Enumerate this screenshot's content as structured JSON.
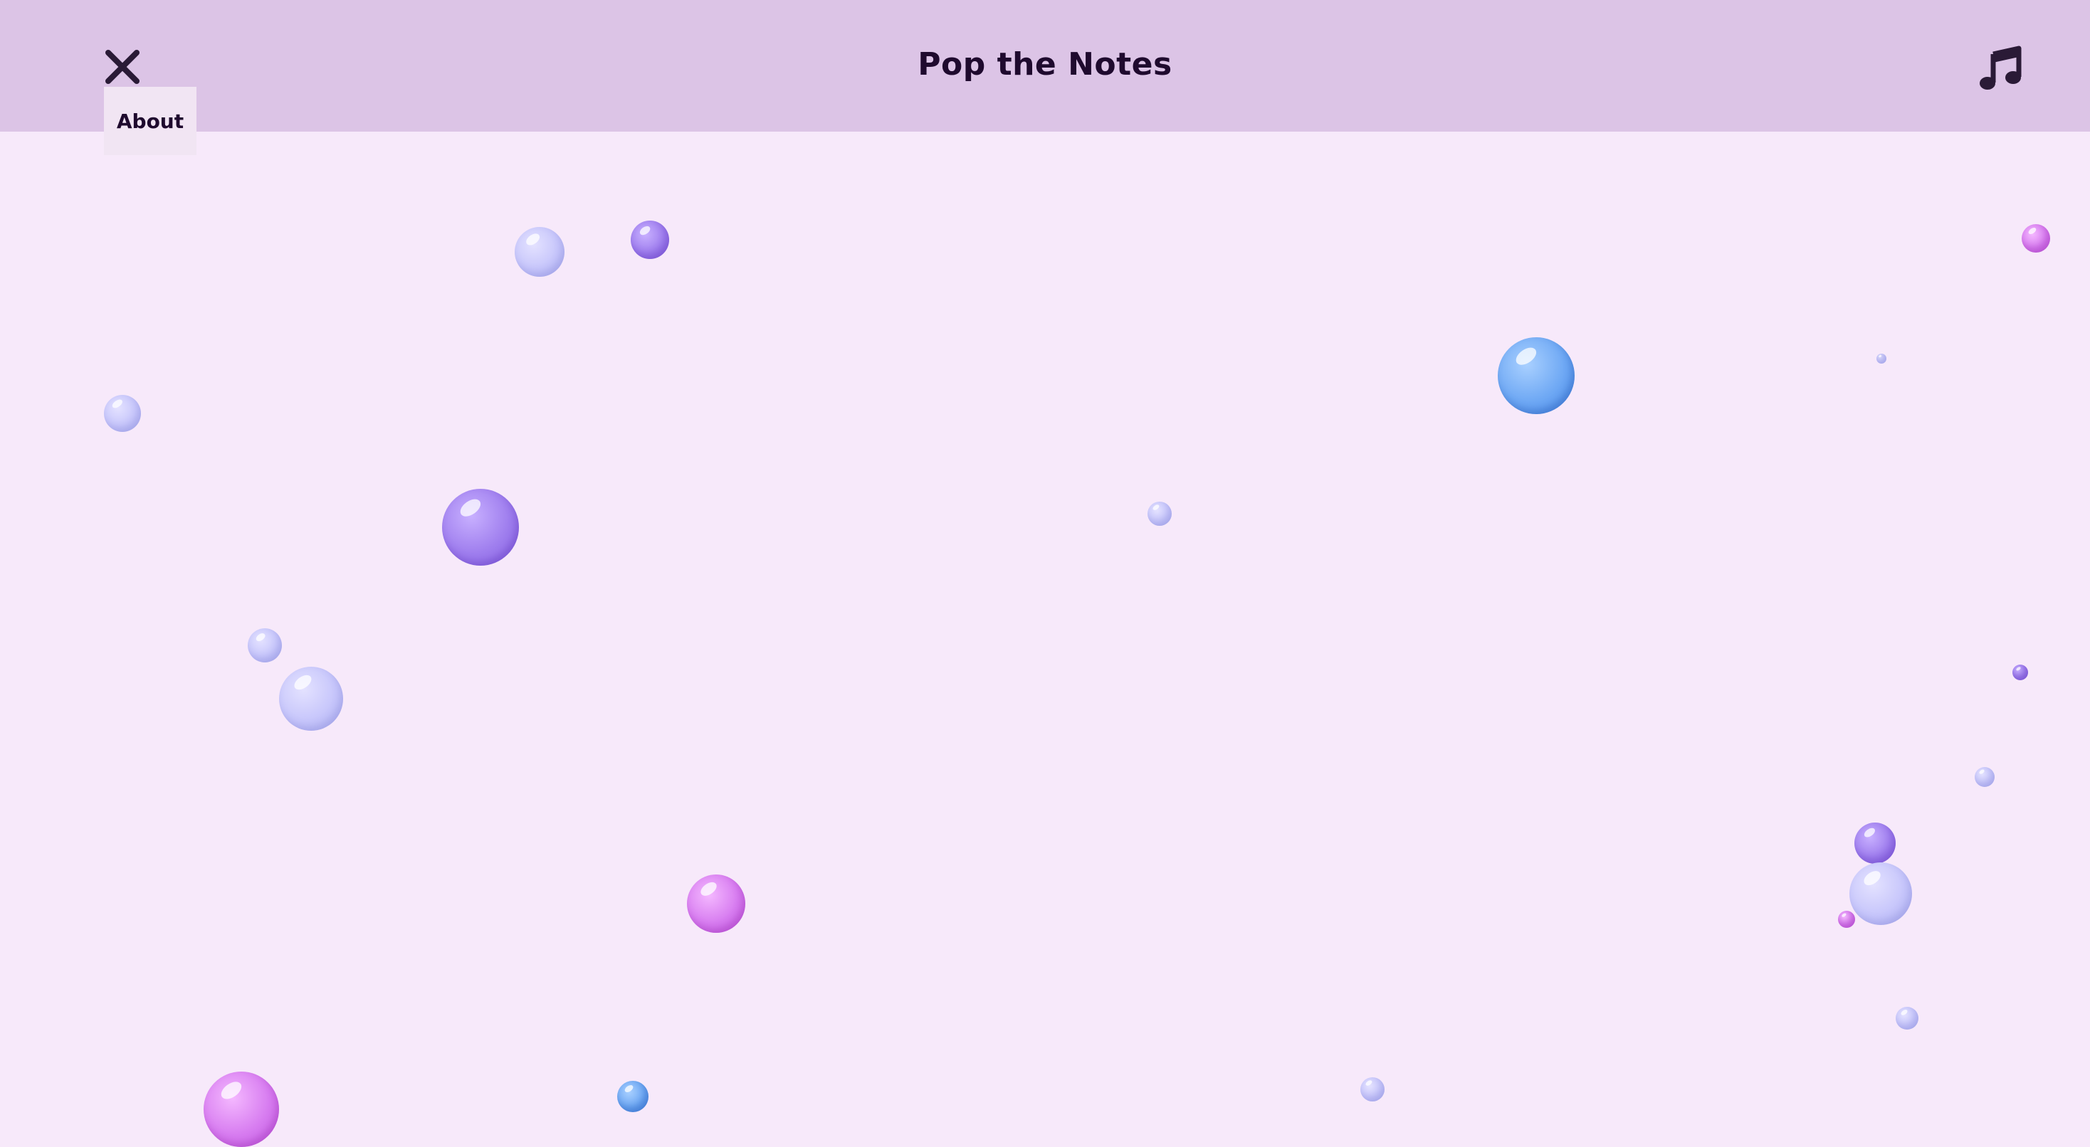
{
  "header": {
    "title": "Pop the Notes",
    "close_icon": "close-icon",
    "music_icon": "music-note-icon",
    "about_label": "About"
  },
  "colors": {
    "header_bg": "#dcc4e6",
    "page_bg": "#f7e9fa",
    "title_color": "#1f0a2e",
    "bubble_purple": "#9f7eee",
    "bubble_lavender": "#c7c6fb",
    "bubble_blue": "#6ea8f4",
    "bubble_pink": "#d77cf0"
  }
}
